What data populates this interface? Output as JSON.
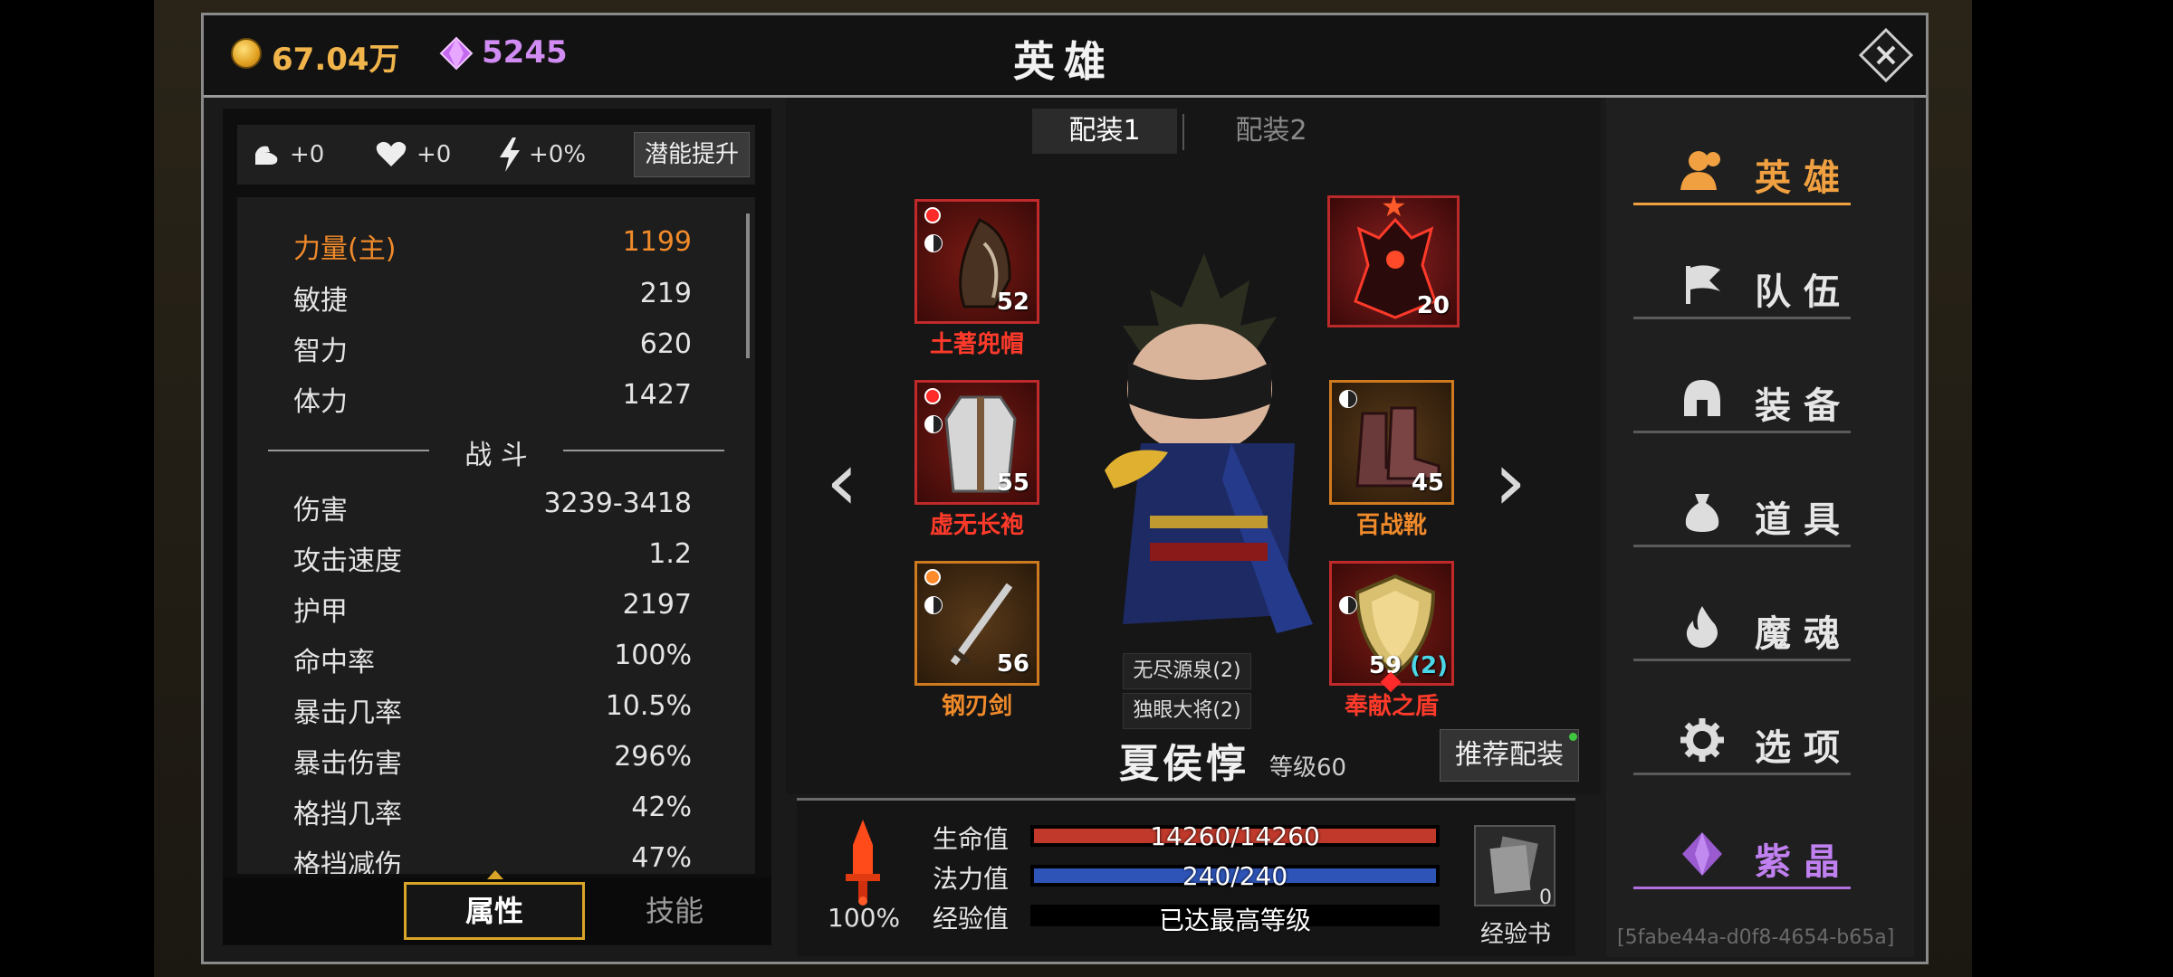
{
  "currency": {
    "gold": "67.04万",
    "gems": "5245"
  },
  "header": {
    "title": "英雄"
  },
  "potential": {
    "might": "+0",
    "health": "+0",
    "speed": "+0%",
    "button": "潜能提升"
  },
  "stats": {
    "primary": [
      {
        "label": "力量(主)",
        "value": "1199"
      },
      {
        "label": "敏捷",
        "value": "219"
      },
      {
        "label": "智力",
        "value": "620"
      },
      {
        "label": "体力",
        "value": "1427"
      }
    ],
    "section": "战 斗",
    "combat": [
      {
        "label": "伤害",
        "value": "3239-3418"
      },
      {
        "label": "攻击速度",
        "value": "1.2"
      },
      {
        "label": "护甲",
        "value": "2197"
      },
      {
        "label": "命中率",
        "value": "100%"
      },
      {
        "label": "暴击几率",
        "value": "10.5%"
      },
      {
        "label": "暴击伤害",
        "value": "296%"
      },
      {
        "label": "格挡几率",
        "value": "42%"
      },
      {
        "label": "格挡减伤",
        "value": "47%"
      }
    ]
  },
  "bottom_tabs": {
    "attributes": "属性",
    "skills": "技能"
  },
  "loadout_tabs": [
    "配装1",
    "配装2"
  ],
  "equipment": [
    {
      "name": "土著兜帽",
      "level": "52"
    },
    {
      "name": "虚无长袍",
      "level": "55"
    },
    {
      "name": "钢刃剑",
      "level": "56"
    },
    {
      "name": "",
      "level": "20"
    },
    {
      "name": "百战靴",
      "level": "45"
    },
    {
      "name": "奉献之盾",
      "level": "59",
      "bonus": "(2)"
    }
  ],
  "sets": [
    "无尽源泉(2)",
    "独眼大将(2)"
  ],
  "hero": {
    "name": "夏侯惇",
    "level": "等级60",
    "recommend": "推荐配装"
  },
  "vitals": {
    "hp_label": "生命值",
    "hp": "14260/14260",
    "hp_fraction": 1.0,
    "mp_label": "法力值",
    "mp": "240/240",
    "mp_fraction": 1.0,
    "exp_label": "经验值",
    "exp": "已达最高等级",
    "power_pct": "100%"
  },
  "exp_book": {
    "count": "0",
    "label": "经验书"
  },
  "nav": [
    "英雄",
    "队伍",
    "装备",
    "道具",
    "魔魂",
    "选项",
    "紫晶"
  ],
  "uid": "[5fabe44a-d0f8-4654-b65a]",
  "colors": {
    "gold": "#f0b44a",
    "gem": "#d08cf2",
    "rare_red": "#ff3a2a",
    "epic_orange": "#f08a2a",
    "nav_active": "#f0a040",
    "nav_gem": "#b070e0"
  }
}
